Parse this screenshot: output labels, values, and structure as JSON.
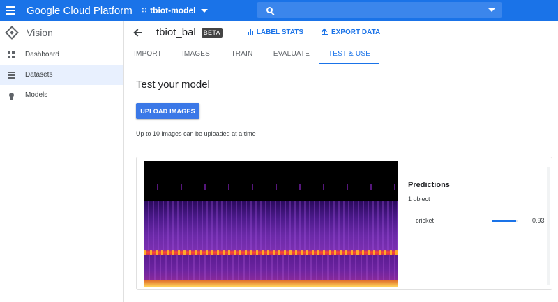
{
  "topbar": {
    "app_title": "Google Cloud Platform",
    "project": "tbiot-model",
    "icons": [
      "menu-icon",
      "project-icon",
      "search-icon",
      "chevron-down-icon"
    ]
  },
  "leftnav": {
    "product": "Vision",
    "items": [
      {
        "label": "Dashboard",
        "icon": "dashboard-icon",
        "active": false
      },
      {
        "label": "Datasets",
        "icon": "list-icon",
        "active": true
      },
      {
        "label": "Models",
        "icon": "lightbulb-icon",
        "active": false
      }
    ]
  },
  "header": {
    "dataset_name": "tbiot_bal",
    "badge": "BETA",
    "actions": {
      "label_stats": "LABEL STATS",
      "export_data": "EXPORT DATA"
    }
  },
  "tabs": [
    {
      "label": "IMPORT",
      "active": false
    },
    {
      "label": "IMAGES",
      "active": false
    },
    {
      "label": "TRAIN",
      "active": false
    },
    {
      "label": "EVALUATE",
      "active": false
    },
    {
      "label": "TEST & USE",
      "active": true
    }
  ],
  "main": {
    "title": "Test your model",
    "upload_button": "UPLOAD IMAGES",
    "hint": "Up to 10 images can be uploaded at a time"
  },
  "predictions": {
    "title": "Predictions",
    "count": "1 object",
    "items": [
      {
        "label": "cricket",
        "score_text": "0.93",
        "score": 0.93
      }
    ]
  },
  "colors": {
    "accent": "#1a73e8",
    "topbar": "#1a73e8",
    "nav_active_bg": "#e8f0fe"
  }
}
